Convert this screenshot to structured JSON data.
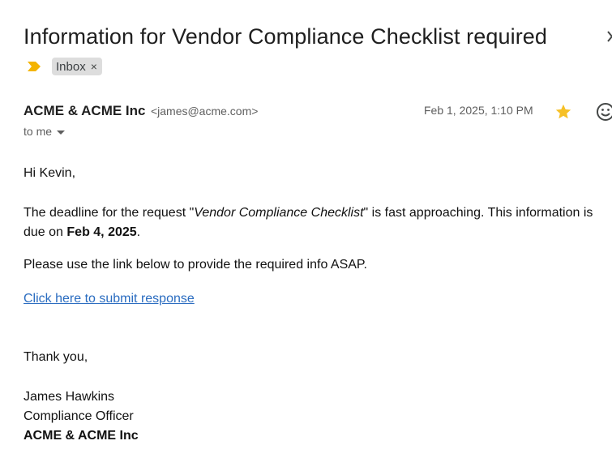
{
  "email": {
    "subject": "Information for Vendor Compliance Checklist required",
    "label": "Inbox",
    "label_remove": "×",
    "sender_name": "ACME & ACME Inc",
    "sender_email": "<james@acme.com>",
    "recipient": "to me",
    "date": "Feb 1, 2025, 1:10 PM",
    "starred": true,
    "important": true,
    "body": {
      "greeting": "Hi Kevin,",
      "deadline_part1": "The deadline for the request \"",
      "deadline_request": "Vendor Compliance Checklist",
      "deadline_part2": "\" is fast approaching. This information is due on ",
      "due_date": "Feb 4, 2025",
      "deadline_end": ".",
      "instruction": "Please use the link below to provide the required info ASAP.",
      "link_text": "Click here to submit response",
      "closing": "Thank you,",
      "signature_name": "James Hawkins",
      "signature_title": "Compliance Officer",
      "signature_company": "ACME & ACME Inc"
    }
  },
  "icons": {
    "importance": "importance-marker-icon",
    "star": "star-icon",
    "emoji": "emoji-reaction-icon",
    "close": "close-icon"
  },
  "colors": {
    "importance": "#f4b400",
    "star": "#f6c026",
    "link": "#2a6cc0",
    "chip_bg": "#dddddd"
  }
}
